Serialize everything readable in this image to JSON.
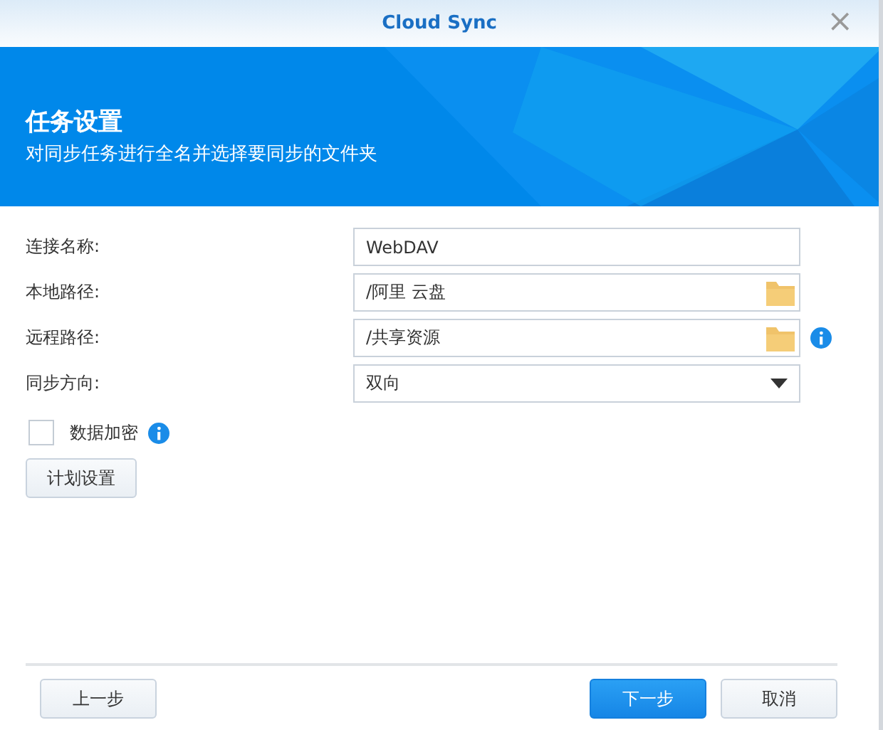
{
  "window": {
    "title": "Cloud Sync",
    "close": "×"
  },
  "header": {
    "title": "任务设置",
    "subtitle": "对同步任务进行全名并选择要同步的文件夹"
  },
  "fields": [
    {
      "label": "连接名称:",
      "kind": "text",
      "value": "WebDAV",
      "info": false
    },
    {
      "label": "本地路径:",
      "kind": "folder",
      "value": "/阿里 云盘",
      "info": false
    },
    {
      "label": "远程路径:",
      "kind": "folder",
      "value": "/共享资源",
      "info": true
    },
    {
      "label": "同步方向:",
      "kind": "select",
      "value": "双向",
      "info": false
    }
  ],
  "encryption": {
    "label": "数据加密",
    "checked": false,
    "info": true
  },
  "schedule_button": "计划设置",
  "footer": {
    "back": "上一步",
    "next": "下一步",
    "cancel": "取消"
  }
}
